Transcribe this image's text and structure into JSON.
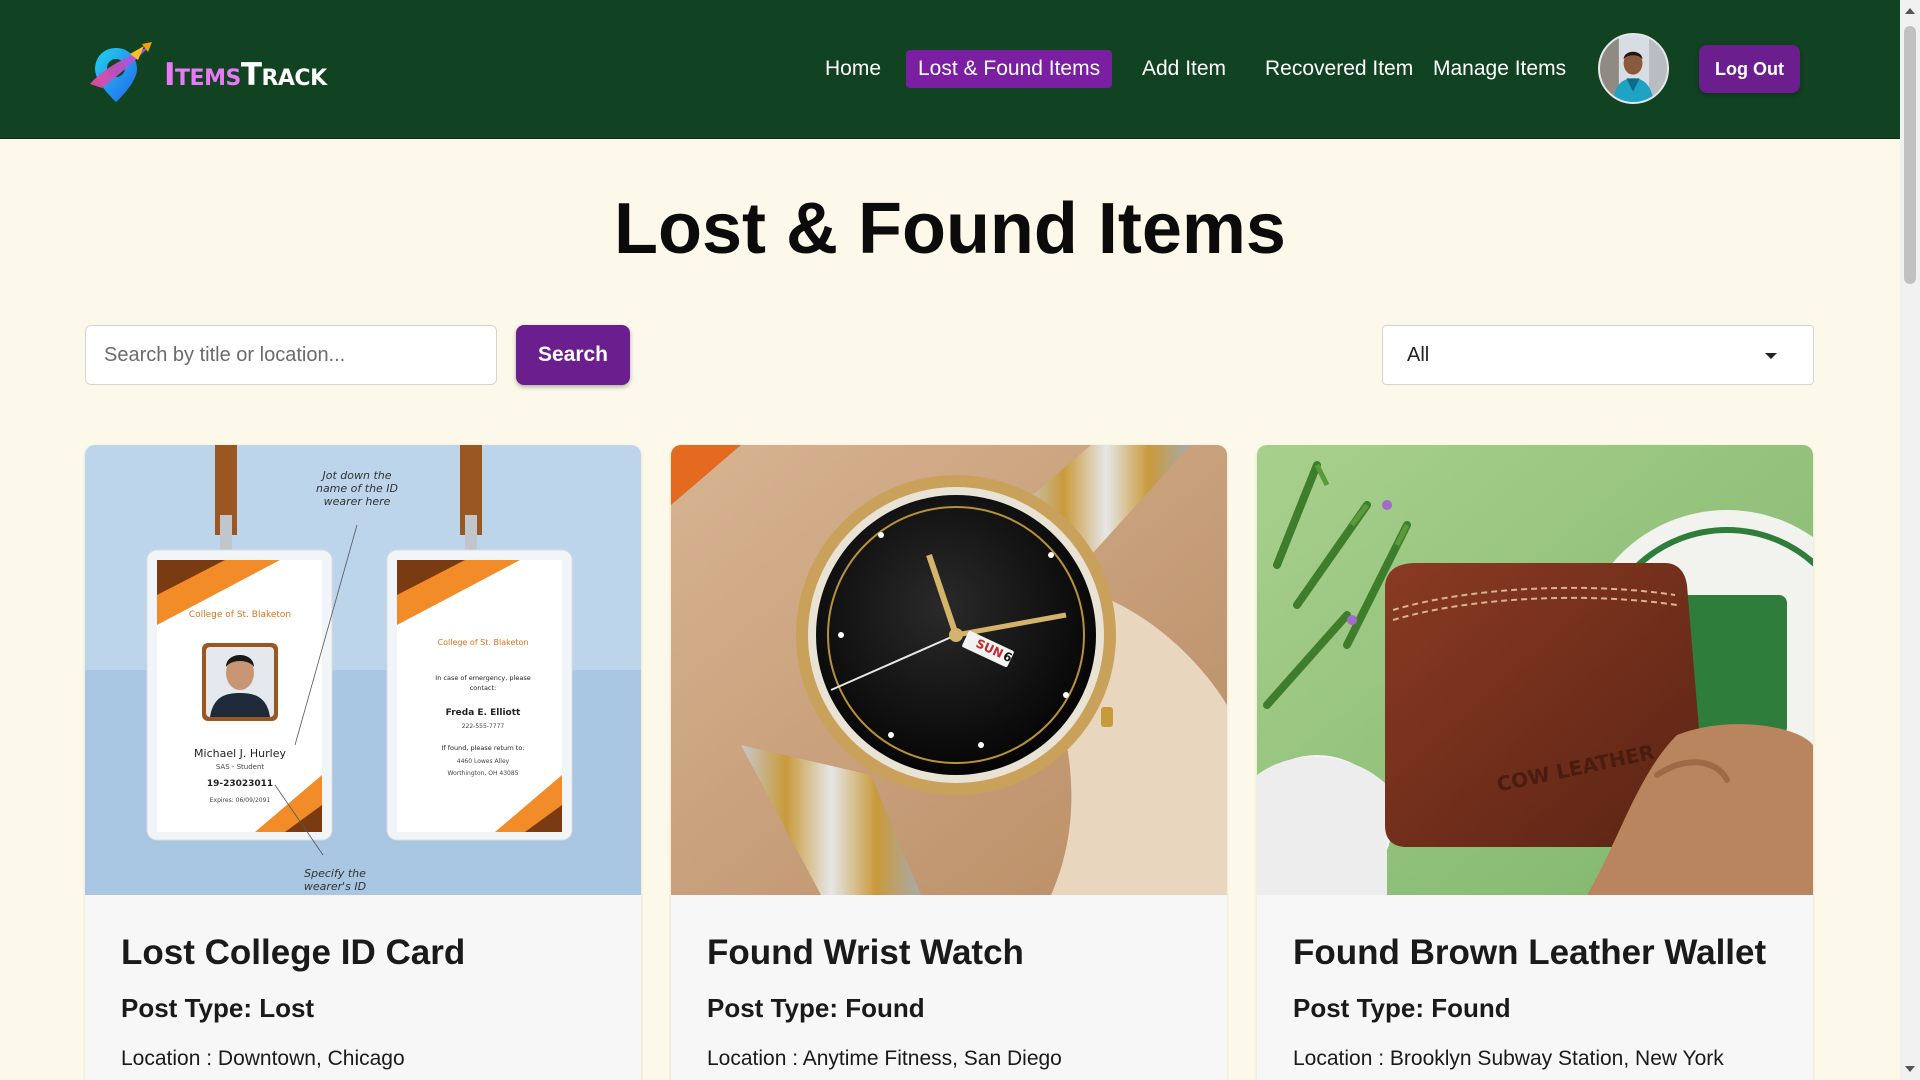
{
  "brand": {
    "name_part1": "Items",
    "name_part2": "Track"
  },
  "nav": {
    "items": [
      {
        "label": "Home",
        "active": false
      },
      {
        "label": "Lost & Found Items",
        "active": true
      },
      {
        "label": "Add Item",
        "active": false
      },
      {
        "label": "Recovered Item",
        "active": false
      },
      {
        "label": "Manage Items",
        "active": false
      }
    ],
    "logout_label": "Log Out"
  },
  "page": {
    "title": "Lost & Found Items"
  },
  "search": {
    "placeholder": "Search by title or location...",
    "value": "",
    "button_label": "Search"
  },
  "filter": {
    "selected": "All"
  },
  "cards": [
    {
      "title": "Lost College ID Card",
      "post_type": "Post Type: Lost",
      "location": "Location : Downtown, Chicago",
      "image": {
        "note_top": [
          "Jot down the",
          "name of the ID",
          "wearer here"
        ],
        "note_bottom": [
          "Specify the",
          "wearer's ID"
        ],
        "college": "College of St. Blaketon",
        "holder_name": "Michael J. Hurley",
        "holder_role": "SAS - Student",
        "id_number": "19-23023011",
        "expires": "Expires: 06/09/2091",
        "emergency_text": [
          "In case of emergency, please",
          "contact:"
        ],
        "emergency_name": "Freda E. Elliott",
        "emergency_phone": "222-555-7777",
        "return_text": "If found, please return to:",
        "return_address": [
          "4460 Lowes Alley",
          "Worthington, OH 43085"
        ]
      }
    },
    {
      "title": "Found Wrist Watch",
      "post_type": "Post Type: Found",
      "location": "Location : Anytime Fitness, San Diego",
      "image": {
        "day_label": "SUN",
        "day_number": "6"
      }
    },
    {
      "title": "Found Brown Leather Wallet",
      "post_type": "Post Type: Found",
      "location": "Location : Brooklyn Subway Station, New York",
      "image": {
        "emboss": "COW LEATHER"
      }
    }
  ],
  "colors": {
    "navbar": "#114221",
    "accent": "#6b1f8f",
    "page_bg": "#fdf9ea",
    "brand_accent": "#e879f9"
  },
  "icons": {
    "logo": "location-pin-rocket-icon",
    "filter_caret": "caret-down-icon"
  }
}
